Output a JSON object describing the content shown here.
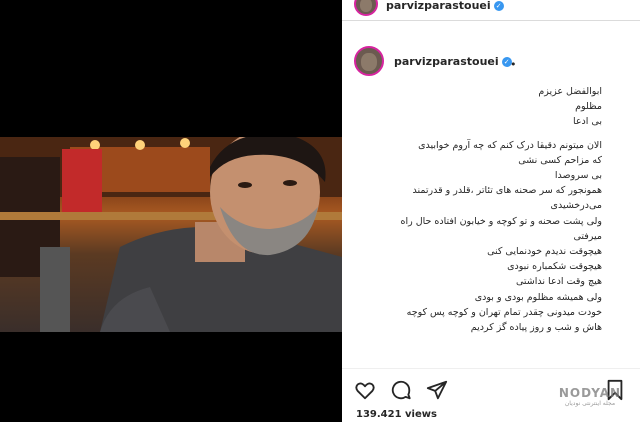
{
  "header": {
    "username": "parvizparastouei"
  },
  "post": {
    "username": "parvizparastouei",
    "separator": "•",
    "caption_lines": [
      "ابوالفضل عزیزم",
      "مظلوم",
      "بی ادعا",
      "",
      "الان میتونم دقیقا درک کنم که چه آروم خوابیدی",
      "که مزاحم کسی نشی",
      "بی سروصدا",
      "همونجور که سر صحنه های تئاتر ،قلدر و قدرتمند",
      "می‌درخشیدی",
      "ولی پشت صحنه و تو کوچه و خیابون افتاده حال راه",
      "میرفتی",
      "هیچوقت ندیدم خودنمایی کنی",
      "هیچوقت شکمباره نبودی",
      "هیچ وقت ادعا نداشتی",
      "ولی همیشه مظلوم بودی و بودی",
      "خودت میدونی چقدر تمام تهران و کوچه پس کوچه",
      "هاش و شب و روز پیاده گز کردیم"
    ]
  },
  "actions": {
    "icons": [
      "heart-icon",
      "comment-icon",
      "share-icon",
      "bookmark-icon"
    ],
    "views": "139.421 views"
  },
  "watermark": {
    "brand": "NODYAN",
    "tagline": "مجله اینترنتی نودیان"
  },
  "colors": {
    "verified": "#3897f0",
    "avatar_ring": "#d6249f",
    "text": "#262626"
  }
}
